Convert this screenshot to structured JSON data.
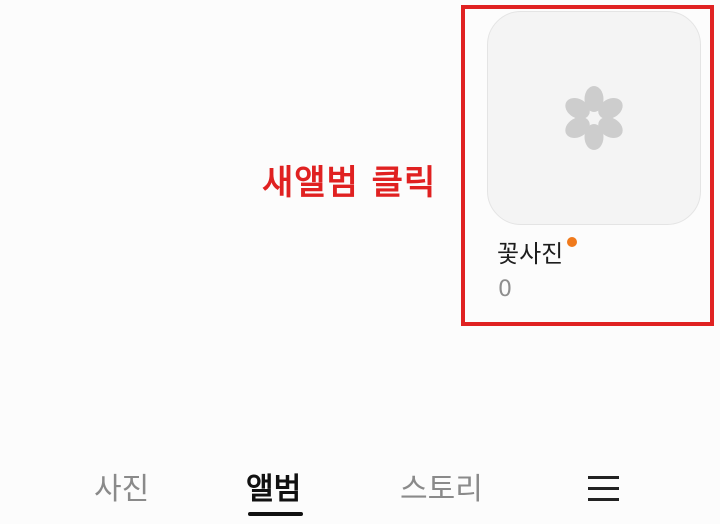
{
  "annotation": {
    "text": "새앨범 클릭",
    "color": "#e02121"
  },
  "album": {
    "name": "꽃사진",
    "count": "0",
    "icon": "flower-icon",
    "new_badge_color": "#f07a1c"
  },
  "tabs": [
    {
      "label": "사진",
      "active": false
    },
    {
      "label": "앨범",
      "active": true
    },
    {
      "label": "스토리",
      "active": false
    }
  ],
  "menu": {
    "icon": "hamburger-menu-icon"
  }
}
